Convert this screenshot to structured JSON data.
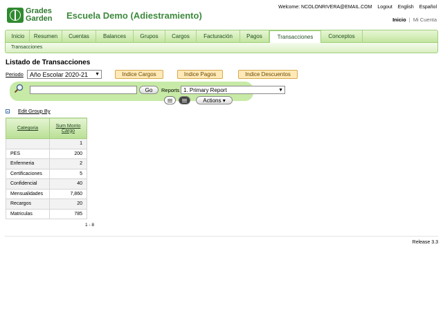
{
  "brand": {
    "logo_line1": "Grades",
    "logo_line2": "Garden",
    "site_title": "Escuela Demo (Adiestramiento)"
  },
  "topbar": {
    "welcome": "Welcome: NCOLONRIVERA@EMAIL.COM",
    "logout": "Logout",
    "english": "English",
    "espanol": "Español",
    "inicio": "Inicio",
    "separator": "|",
    "mi_cuenta": "Mi Cuenta"
  },
  "nav": {
    "tabs": [
      "Inicio",
      "Resumen",
      "Cuentas",
      "Balances",
      "Grupos",
      "Cargos",
      "Facturación",
      "Pagos",
      "Transacciones",
      "Conceptos"
    ],
    "active": "Transacciones",
    "subnav": "Transacciones"
  },
  "page": {
    "title": "Listado de Transacciones",
    "periodo_label": "Periodo",
    "periodo_value": "Año Escolar 2020-21",
    "btn_cargos": "Indice Cargos",
    "btn_pagos": "Indice Pagos",
    "btn_descuentos": "Indice Descuentos"
  },
  "search": {
    "value": "",
    "go": "Go",
    "reports_label": "Reports",
    "reports_value": "1. Primary Report",
    "actions": "Actions ▾"
  },
  "report": {
    "edit_group": "Edit Group By",
    "columns": [
      "Categoria",
      "Sum Monto Cargo"
    ],
    "rows": [
      {
        "categoria": "",
        "monto": "1"
      },
      {
        "categoria": "PES",
        "monto": "200"
      },
      {
        "categoria": "Enfermeria",
        "monto": "2"
      },
      {
        "categoria": "Certificaciones",
        "monto": "5"
      },
      {
        "categoria": "Confidencial",
        "monto": "40"
      },
      {
        "categoria": "Mensualidades",
        "monto": "7,860"
      },
      {
        "categoria": "Recargos",
        "monto": "20"
      },
      {
        "categoria": "Matriculas",
        "monto": "785"
      }
    ],
    "pagination": "1 - 8"
  },
  "footer": {
    "release": "Release 3.3"
  },
  "colors": {
    "brand_green": "#3d8a3d",
    "nav_bg": "#c3e6a0",
    "button_yellow": "#ffe9b8"
  }
}
